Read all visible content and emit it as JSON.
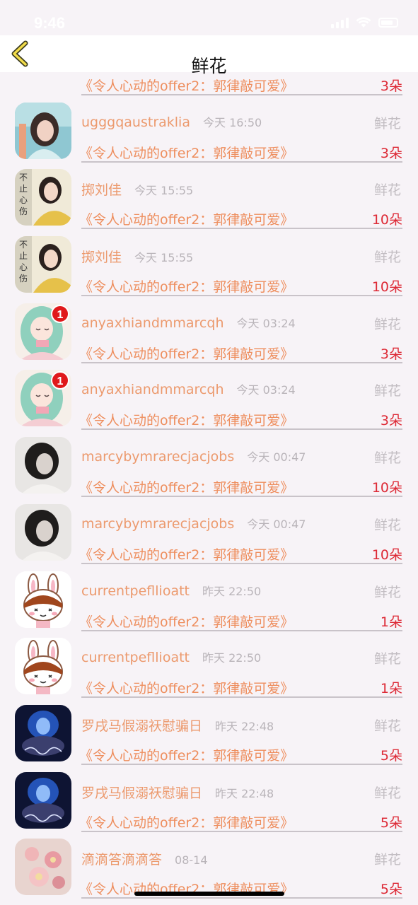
{
  "status_bar": {
    "time": "9:46"
  },
  "nav": {
    "title": "鲜花"
  },
  "rows": [
    {
      "user": "",
      "time": "",
      "type": "",
      "message": "《令人心动的offer2：郭律敲可爱》",
      "count": "3朵",
      "avatar": "girl-teal",
      "badge": ""
    },
    {
      "user": "ugggqaustraklia",
      "time": "今天 16:50",
      "type": "鲜花",
      "message": "《令人心动的offer2：郭律敲可爱》",
      "count": "3朵",
      "avatar": "girl-teal",
      "badge": ""
    },
    {
      "user": "掷刘佳",
      "time": "今天 15:55",
      "type": "鲜花",
      "message": "《令人心动的offer2：郭律敲可爱》",
      "count": "10朵",
      "avatar": "girl-yellow",
      "badge": ""
    },
    {
      "user": "掷刘佳",
      "time": "今天 15:55",
      "type": "鲜花",
      "message": "《令人心动的offer2：郭律敲可爱》",
      "count": "10朵",
      "avatar": "girl-yellow",
      "badge": ""
    },
    {
      "user": "anyaxhiandmmarcqh",
      "time": "今天 03:24",
      "type": "鲜花",
      "message": "《令人心动的offer2：郭律敲可爱》",
      "count": "3朵",
      "avatar": "anime-green",
      "badge": "1"
    },
    {
      "user": "anyaxhiandmmarcqh",
      "time": "今天 03:24",
      "type": "鲜花",
      "message": "《令人心动的offer2：郭律敲可爱》",
      "count": "3朵",
      "avatar": "anime-green",
      "badge": "1"
    },
    {
      "user": "marcybymrarecjacjobs",
      "time": "今天 00:47",
      "type": "鲜花",
      "message": "《令人心动的offer2：郭律敲可爱》",
      "count": "10朵",
      "avatar": "girl-bw",
      "badge": ""
    },
    {
      "user": "marcybymrarecjacjobs",
      "time": "今天 00:47",
      "type": "鲜花",
      "message": "《令人心动的offer2：郭律敲可爱》",
      "count": "10朵",
      "avatar": "girl-bw",
      "badge": ""
    },
    {
      "user": "currentpefllioatt",
      "time": "昨天 22:50",
      "type": "鲜花",
      "message": "《令人心动的offer2：郭律敲可爱》",
      "count": "1朵",
      "avatar": "bunny",
      "badge": ""
    },
    {
      "user": "currentpefllioatt",
      "time": "昨天 22:50",
      "type": "鲜花",
      "message": "《令人心动的offer2：郭律敲可爱》",
      "count": "1朵",
      "avatar": "bunny",
      "badge": ""
    },
    {
      "user": "罗戌马假溺祆慰骗日",
      "time": "昨天 22:48",
      "type": "鲜花",
      "message": "《令人心动的offer2：郭律敲可爱》",
      "count": "5朵",
      "avatar": "blue-light",
      "badge": ""
    },
    {
      "user": "罗戌马假溺祆慰骗日",
      "time": "昨天 22:48",
      "type": "鲜花",
      "message": "《令人心动的offer2：郭律敲可爱》",
      "count": "5朵",
      "avatar": "blue-light",
      "badge": ""
    },
    {
      "user": "滴滴答滴滴答",
      "time": "08-14",
      "type": "鲜花",
      "message": "《令人心动的offer2：郭律敲可爱》",
      "count": "5朵",
      "avatar": "pink-flower",
      "badge": ""
    }
  ]
}
